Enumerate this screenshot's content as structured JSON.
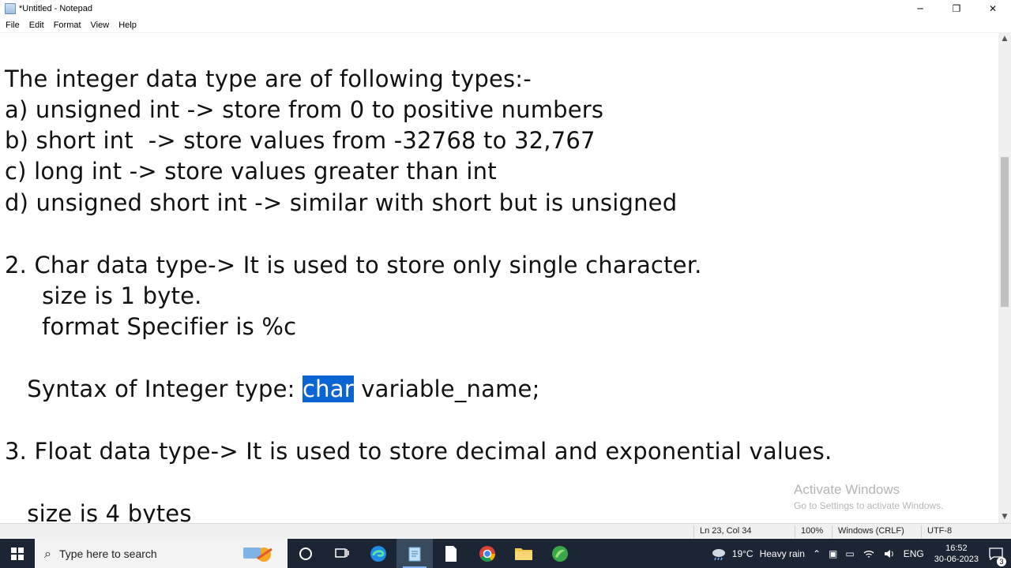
{
  "window": {
    "title": "*Untitled - Notepad",
    "minimize_glyph": "─",
    "restore_glyph": "❐",
    "close_glyph": "✕"
  },
  "menu": [
    "File",
    "Edit",
    "Format",
    "View",
    "Help"
  ],
  "editor": {
    "lines": [
      "The integer data type are of following types:-",
      "a) unsigned int -> store from 0 to positive numbers",
      "b) short int  -> store values from -32768 to 32,767",
      "c) long int -> store values greater than int",
      "d) unsigned short int -> similar with short but is unsigned",
      "",
      "2. Char data type-> It is used to store only single character.",
      "     size is 1 byte.",
      "     format Specifier is %c",
      "",
      "   Syntax of Integer type: ",
      "",
      "3. Float data type-> It is used to store decimal and exponential values.",
      "",
      "   size is 4 bytes"
    ],
    "syntax_prefix": "   Syntax of Integer type: ",
    "selected_text": "char",
    "syntax_suffix": " variable_name;"
  },
  "statusbar": {
    "position": "Ln 23, Col 34",
    "zoom": "100%",
    "line_ending": "Windows (CRLF)",
    "encoding": "UTF-8"
  },
  "watermark": {
    "line1": "Activate Windows",
    "line2": "Go to Settings to activate Windows."
  },
  "taskbar": {
    "search_placeholder": "Type here to search",
    "weather_temp": "19°C",
    "weather_text": "Heavy rain",
    "language": "ENG",
    "time": "16:52",
    "date": "30-06-2023",
    "notification_count": "3"
  },
  "colors": {
    "selection": "#0a64d4",
    "taskbar": "#1c2533"
  }
}
